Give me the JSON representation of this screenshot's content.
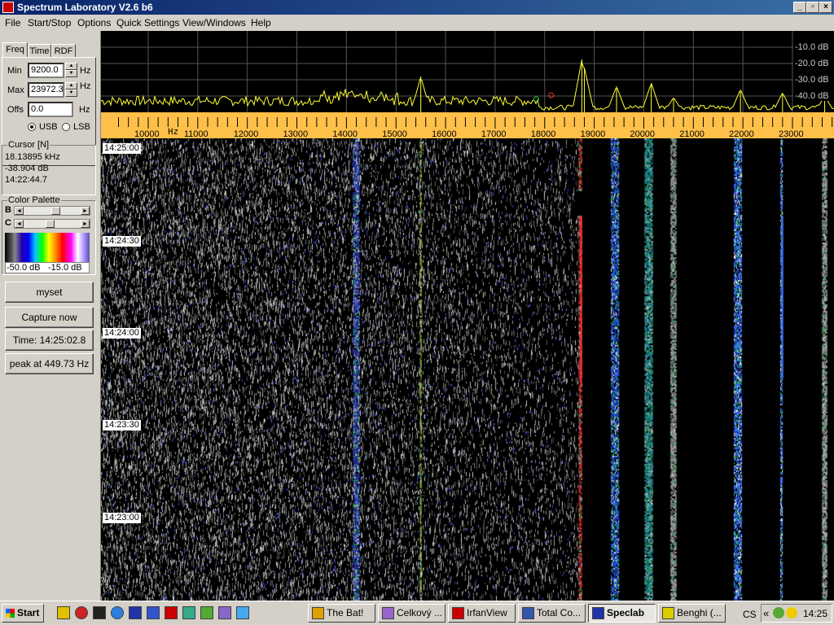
{
  "window": {
    "title": "Spectrum Laboratory V2.6 b6",
    "btn_min": "_",
    "btn_max": "▫",
    "btn_close": "×"
  },
  "menu": [
    "File",
    "Start/Stop",
    "Options",
    "Quick Settings",
    "View/Windows",
    "Help"
  ],
  "tabs": [
    "Freq",
    "Time",
    "RDF"
  ],
  "freq": {
    "min_label": "Min",
    "min_value": "9200.0",
    "min_unit": "Hz",
    "max_label": "Max",
    "max_value": "23972.3",
    "max_unit": "Hz",
    "offs_label": "Offs",
    "offs_value": "0.0",
    "offs_unit": "Hz",
    "usb_label": "USB",
    "lsb_label": "LSB",
    "mode": "USB"
  },
  "cursor": {
    "title": "Cursor [N]",
    "freq": "18.13895 kHz",
    "level": "-38.904 dB",
    "time": "14:22:44.7"
  },
  "palette": {
    "title": "Color Palette",
    "b_label": "B",
    "c_label": "C",
    "b_value": 0.55,
    "c_value": 0.45,
    "min_db": "-50.0 dB",
    "max_db": "-15.0 dB"
  },
  "buttons": {
    "myset": "myset",
    "capture": "Capture now",
    "time": "Time:  14:25:02.8",
    "peak": "peak at 449.73 Hz"
  },
  "spectrum": {
    "db_labels": [
      "-10.0 dB",
      "-20.0 dB",
      "-30.0 dB",
      "-40.0 dB"
    ],
    "freq_min": 9200,
    "freq_max": 23972.3,
    "peaks": [
      {
        "f": 15500,
        "h": 44
      },
      {
        "f": 18750,
        "h": 65
      },
      {
        "f": 18800,
        "h": 55
      },
      {
        "f": 19450,
        "h": 32
      },
      {
        "f": 20150,
        "h": 36
      },
      {
        "f": 20600,
        "h": 18
      },
      {
        "f": 21950,
        "h": 28
      },
      {
        "f": 22800,
        "h": 24
      },
      {
        "f": 23650,
        "h": 20
      }
    ]
  },
  "freq_axis": {
    "hz_label": "Hz",
    "ticks": [
      "10000",
      "11000",
      "12000",
      "13000",
      "14000",
      "15000",
      "16000",
      "17000",
      "18000",
      "19000",
      "20000",
      "21000",
      "22000",
      "23000"
    ]
  },
  "waterfall": {
    "time_labels": [
      "14:25:00",
      "14:24:30",
      "14:24:00",
      "14:23:30",
      "14:23:00"
    ],
    "bands": [
      {
        "f": 14200,
        "color": "#3344dd",
        "w": 8
      },
      {
        "f": 15500,
        "color": "#aacc33",
        "w": 2
      },
      {
        "f": 18720,
        "color": "#ff3333",
        "w": 4
      },
      {
        "f": 19420,
        "color": "#2a60ff",
        "w": 10
      },
      {
        "f": 20100,
        "color": "#2bb0c0",
        "w": 10
      },
      {
        "f": 20600,
        "color": "#bbbbbb",
        "w": 7
      },
      {
        "f": 21900,
        "color": "#3a6cff",
        "w": 10
      },
      {
        "f": 22780,
        "color": "#4477ff",
        "w": 3
      },
      {
        "f": 23650,
        "color": "#cccccc",
        "w": 6
      }
    ]
  },
  "taskbar": {
    "start": "Start",
    "tasks": [
      {
        "label": "The Bat!",
        "color": "#e0a000"
      },
      {
        "label": "Celkový ...",
        "color": "#9966cc"
      },
      {
        "label": "IrfanView",
        "color": "#cc0000"
      },
      {
        "label": "Total Co...",
        "color": "#3355aa"
      },
      {
        "label": "Speclab",
        "color": "#2233aa",
        "active": true
      },
      {
        "label": "Benghi (...",
        "color": "#ddcc00"
      }
    ],
    "tray_prefix": "CS",
    "tray_arrows": "«",
    "clock": "14:25"
  }
}
